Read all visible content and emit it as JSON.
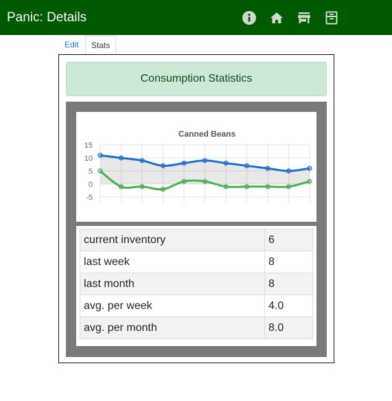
{
  "header": {
    "title": "Panic: Details",
    "icons": [
      "info-icon",
      "home-icon",
      "store-icon",
      "inventory-icon"
    ]
  },
  "tabs": [
    {
      "label": "Edit",
      "active": false
    },
    {
      "label": "Stats",
      "active": true
    }
  ],
  "panel": {
    "heading": "Consumption Statistics"
  },
  "stats_table": [
    {
      "label": "current inventory",
      "value": "6"
    },
    {
      "label": "last week",
      "value": "8"
    },
    {
      "label": "last month",
      "value": "8"
    },
    {
      "label": "avg. per week",
      "value": "4.0"
    },
    {
      "label": "avg. per month",
      "value": "8.0"
    }
  ],
  "colors": {
    "topbar": "#005a00",
    "series_blue": "#1e6fd0",
    "series_green": "#4caf50",
    "header_bg": "#cde9d5"
  },
  "chart_data": {
    "type": "line",
    "title": "Canned Beans",
    "xlabel": "",
    "ylabel": "",
    "ylim": [
      -5,
      15
    ],
    "yticks": [
      15,
      10,
      5,
      0,
      -5
    ],
    "grid": true,
    "x": [
      1,
      2,
      3,
      4,
      5,
      6,
      7,
      8,
      9,
      10,
      11
    ],
    "series": [
      {
        "values": [
          11,
          10,
          9,
          7,
          8,
          9,
          8,
          7,
          6,
          5,
          6
        ],
        "color": "#1e6fd0"
      },
      {
        "values": [
          5,
          -1,
          -1,
          -2,
          1,
          1,
          -1,
          -1,
          -1,
          -1,
          1
        ],
        "color": "#4caf50"
      }
    ]
  }
}
